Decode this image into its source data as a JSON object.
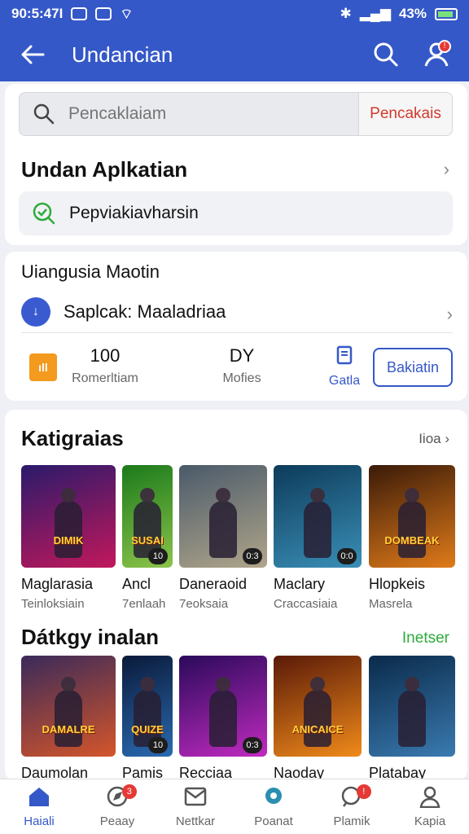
{
  "status_bar": {
    "time": "90:5:47I",
    "battery": "43%"
  },
  "app_bar": {
    "title": "Undancian",
    "notif_count": "!"
  },
  "search": {
    "placeholder": "Pencaklaiam",
    "button_label": "Pencakais"
  },
  "card1": {
    "section_title": "Undan Aplkatian",
    "recommend_text": "Pepviakiavharsin"
  },
  "card2": {
    "title": "Uiangusia Maotin",
    "app_name": "Saplcak: Maaladriaa",
    "stats": [
      {
        "value": "100",
        "label": "Romerltiam"
      },
      {
        "value": "DY",
        "label": "Mofies"
      },
      {
        "value": "",
        "label": "Gatla"
      }
    ],
    "action_label": "Bakiatin"
  },
  "categories": {
    "title": "Katigraias",
    "link": "Iioa",
    "items": [
      {
        "name": "Maglarasia",
        "sub": "Teinloksiain",
        "badge": "",
        "art": "DIMIK",
        "colors": [
          "#2a1a6b",
          "#c2185b"
        ]
      },
      {
        "name": "Ancl",
        "sub": "7enlaah",
        "badge": "10",
        "art": "SUSAI",
        "colors": [
          "#1b7a1b",
          "#8bc34a"
        ]
      },
      {
        "name": "Daneraoid",
        "sub": "7eoksaia",
        "badge": "0:3",
        "art": "",
        "colors": [
          "#4a5a6a",
          "#b0a58a"
        ]
      },
      {
        "name": "Maclary",
        "sub": "Craccasiaia",
        "badge": "0:0",
        "art": "",
        "colors": [
          "#0d3b5a",
          "#3a8fb7"
        ]
      },
      {
        "name": "Hlopkeis",
        "sub": "Masrela",
        "badge": "",
        "art": "DOMBEAK",
        "colors": [
          "#3a1a08",
          "#e07b1a"
        ]
      }
    ]
  },
  "daily": {
    "title": "Dátkgy inalan",
    "link": "Inetser",
    "items": [
      {
        "name": "Daumolan",
        "badge": "",
        "art": "DAMALRE",
        "colors": [
          "#3a2a5a",
          "#d4552a"
        ]
      },
      {
        "name": "Pamis",
        "badge": "10",
        "art": "QUIZE",
        "colors": [
          "#0a1a3a",
          "#2a6ab0"
        ]
      },
      {
        "name": "Recciaa",
        "badge": "0:3",
        "art": "",
        "colors": [
          "#2a0a5a",
          "#c02ac0"
        ]
      },
      {
        "name": "Naoday",
        "badge": "",
        "art": "ANICAICE",
        "colors": [
          "#5a1a08",
          "#f08a1a"
        ]
      },
      {
        "name": "Platabay",
        "badge": "",
        "art": "",
        "colors": [
          "#0a2a4a",
          "#3a7ab0"
        ]
      }
    ]
  },
  "bottom_nav": [
    {
      "label": "Haiali",
      "icon": "home-icon",
      "badge": "",
      "active": true
    },
    {
      "label": "Peaay",
      "icon": "compass-icon",
      "badge": "3",
      "active": false
    },
    {
      "label": "Nettkar",
      "icon": "mail-icon",
      "badge": "",
      "active": false
    },
    {
      "label": "Poanat",
      "icon": "chat-icon",
      "badge": "",
      "active": false
    },
    {
      "label": "Plamik",
      "icon": "message-icon",
      "badge": "!",
      "active": false
    },
    {
      "label": "Kapia",
      "icon": "user-icon",
      "badge": "",
      "active": false
    }
  ]
}
